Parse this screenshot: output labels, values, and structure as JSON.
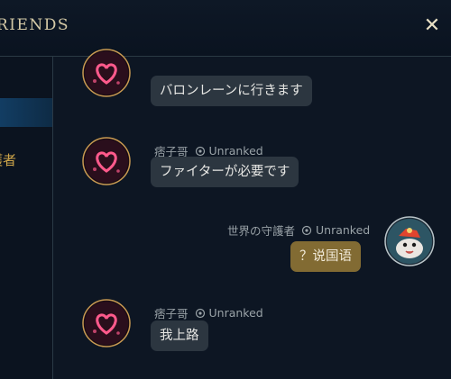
{
  "header": {
    "title": "RIENDS",
    "close_label": "✕"
  },
  "sidebar": {
    "partial_label": "護者"
  },
  "messages": [
    {
      "sender": "",
      "rank": "",
      "text": "バロンレーンに行きます",
      "mine": false
    },
    {
      "sender": "痞子哥",
      "rank": "Unranked",
      "text": "ファイターが必要です",
      "mine": false
    },
    {
      "sender": "世界の守護者",
      "rank": "Unranked",
      "text": "？说国语",
      "mine": true
    },
    {
      "sender": "痞子哥",
      "rank": "Unranked",
      "text": "我上路",
      "mine": false
    }
  ],
  "colors": {
    "accent_gold": "#cfa64a",
    "my_bubble": "#826b33",
    "their_bubble": "#2c3640",
    "heart_pink": "#ff5a8c"
  },
  "icons": {
    "close": "close-icon",
    "rank": "rank-emblem-icon",
    "heart_avatar": "heart-avatar-icon",
    "poro_avatar": "poro-avatar-icon"
  }
}
